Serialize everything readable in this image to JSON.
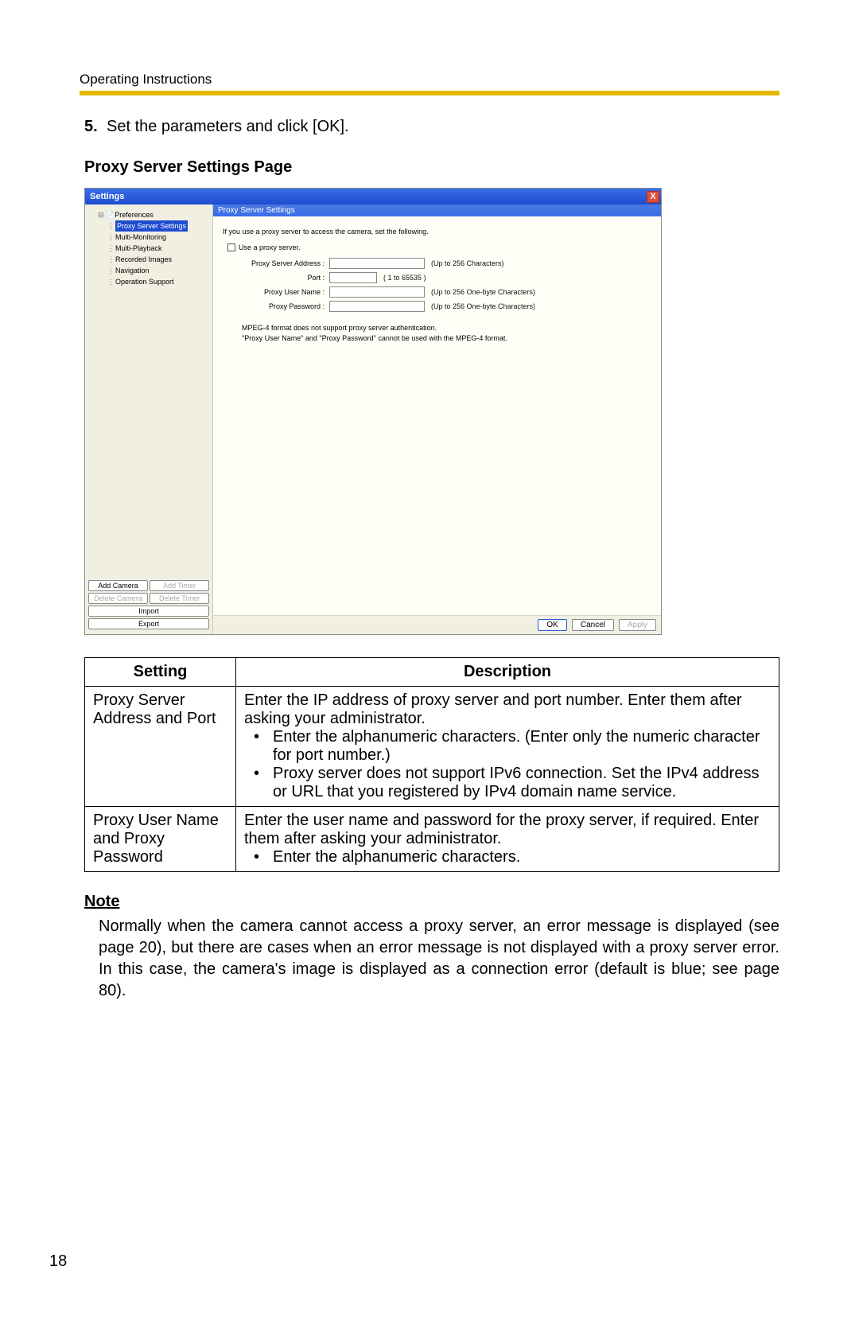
{
  "header": "Operating Instructions",
  "step": {
    "num": "5.",
    "text": "Set the parameters and click [OK]."
  },
  "section_title": "Proxy Server Settings Page",
  "dialog": {
    "title": "Settings",
    "close_glyph": "X",
    "tree": {
      "root": "Preferences",
      "items": [
        "Proxy Server Settings",
        "Multi-Monitoring",
        "Multi-Playback",
        "Recorded Images",
        "Navigation",
        "Operation Support"
      ]
    },
    "side_buttons": {
      "add_camera": "Add Camera",
      "add_timer": "Add Timer",
      "delete_camera": "Delete Camera",
      "delete_timer": "Delete Timer",
      "import": "Import",
      "export": "Export"
    },
    "panel": {
      "header": "Proxy Server Settings",
      "intro": "If you use a proxy server to access the camera, set the following.",
      "checkbox_label": "Use a proxy server.",
      "fields": {
        "address": {
          "label": "Proxy Server Address :",
          "hint": "(Up to 256 Characters)"
        },
        "port": {
          "label": "Port :",
          "hint": "( 1 to 65535 )"
        },
        "user": {
          "label": "Proxy User Name :",
          "hint": "(Up to 256 One-byte Characters)"
        },
        "pass": {
          "label": "Proxy Password :",
          "hint": "(Up to 256 One-byte Characters)"
        }
      },
      "note_line1": "MPEG-4 format does not support proxy server authentication.",
      "note_line2": "\"Proxy User Name\" and \"Proxy Password\" cannot be used with the MPEG-4 format."
    },
    "footer": {
      "ok": "OK",
      "cancel": "Cancel",
      "apply": "Apply"
    }
  },
  "table": {
    "head_setting": "Setting",
    "head_description": "Description",
    "row1": {
      "setting": "Proxy Server Address and Port",
      "intro1": "Enter the IP address of proxy server and port number. Enter them after asking your administrator.",
      "bullet1": "Enter the alphanumeric characters. (Enter only the numeric character for port number.)",
      "bullet2": "Proxy server does not support IPv6 connection. Set the IPv4 address or URL that you registered by IPv4 domain name service."
    },
    "row2": {
      "setting": "Proxy User Name and Proxy Password",
      "intro1": "Enter the user name and password for the proxy server, if required. Enter them after asking your administrator.",
      "bullet1": "Enter the alphanumeric characters."
    }
  },
  "note": {
    "heading": "Note",
    "body": "Normally when the camera cannot access a proxy server, an error message is displayed (see page 20), but there are cases when an error message is not displayed with a proxy server error. In this case, the camera's image is displayed as a connection error (default is blue; see page 80)."
  },
  "page_number": "18"
}
